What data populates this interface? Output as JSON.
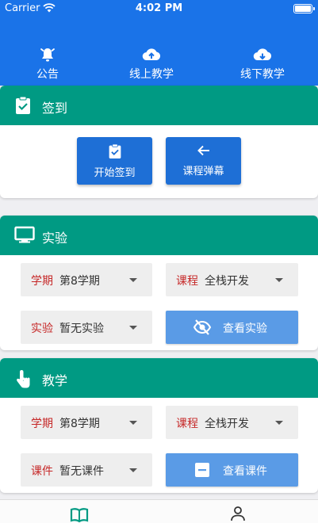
{
  "status_bar": {
    "carrier": "Carrier",
    "time": "4:02 PM"
  },
  "top_nav": {
    "tabs": [
      {
        "label": "公告",
        "icon": "bell-icon"
      },
      {
        "label": "线上教学",
        "icon": "cloud-upload-icon"
      },
      {
        "label": "线下教学",
        "icon": "cloud-download-icon"
      }
    ]
  },
  "checkin": {
    "title": "签到",
    "start_button": "开始签到",
    "barrage_button": "课程弹幕"
  },
  "experiment": {
    "title": "实验",
    "term_key": "学期",
    "term_value": "第8学期",
    "course_key": "课程",
    "course_value": "全栈开发",
    "exp_key": "实验",
    "exp_value": "暂无实验",
    "view_button": "查看实验"
  },
  "teaching": {
    "title": "教学",
    "term_key": "学期",
    "term_value": "第8学期",
    "course_key": "课程",
    "course_value": "全栈开发",
    "courseware_key": "课件",
    "courseware_value": "暂无课件",
    "view_button": "查看课件"
  },
  "bottom_nav": {
    "items": [
      "book-icon",
      "person-icon"
    ]
  },
  "colors": {
    "primary_blue": "#1a73e8",
    "teal": "#009a83",
    "key_red": "#c62828",
    "light_blue": "#5a9be6"
  }
}
